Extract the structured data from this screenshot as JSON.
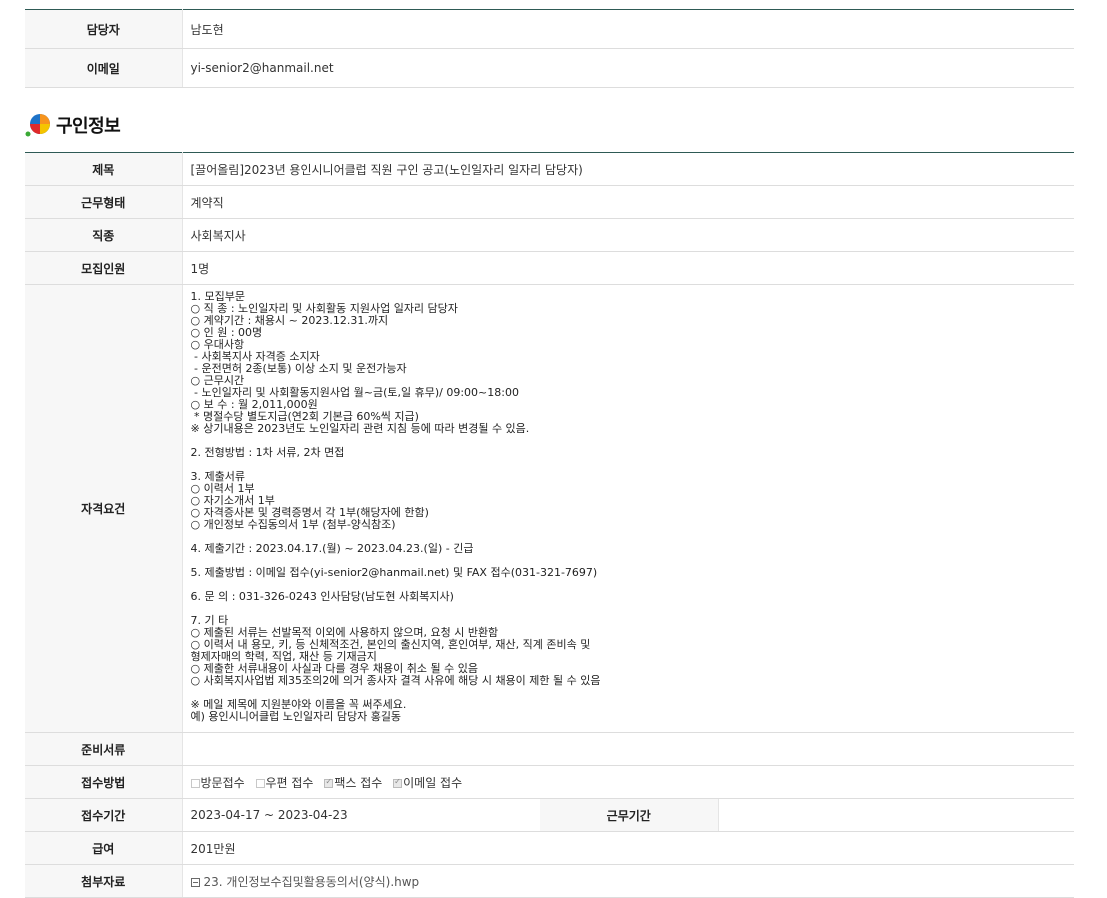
{
  "contact": {
    "manager_label": "담당자",
    "manager_value": "남도현",
    "email_label": "이메일",
    "email_value": "yi-senior2@hanmail.net"
  },
  "section": {
    "title": "구인정보",
    "logo_icon": "colorful-circle-logo-icon"
  },
  "info": {
    "title_label": "제목",
    "title_value": "[끌어올림]2023년 용인시니어클럽 직원 구인 공고(노인일자리 일자리 담당자)",
    "worktype_label": "근무형태",
    "worktype_value": "계약직",
    "job_label": "직종",
    "job_value": "사회복지사",
    "headcount_label": "모집인원",
    "headcount_value": "1명",
    "req_label": "자격요건",
    "req_lines": [
      "1. 모집부문",
      "○ 직 종 : 노인일자리 및 사회활동 지원사업 일자리 담당자",
      "○ 계약기간 : 채용시 ~ 2023.12.31.까지",
      "○ 인 원 : 00명",
      "○ 우대사항",
      " - 사회복지사 자격증 소지자",
      " - 운전면허 2종(보통) 이상 소지 및 운전가능자",
      "○ 근무시간",
      " - 노인일자리 및 사회활동지원사업 월~금(토,일 휴무)/ 09:00~18:00",
      "○ 보 수 : 월 2,011,000원",
      " * 명절수당 별도지급(연2회 기본급 60%씩 지급)",
      "※ 상기내용은 2023년도 노인일자리 관련 지침 등에 따라 변경될 수 있음.",
      "",
      "2. 전형방법 : 1차 서류, 2차 면접",
      "",
      "3. 제출서류",
      "○ 이력서 1부",
      "○ 자기소개서 1부",
      "○ 자격증사본 및 경력증명서 각 1부(해당자에 한함)",
      "○ 개인정보 수집동의서 1부 (첨부-양식참조)",
      "",
      "4. 제출기간 : 2023.04.17.(월) ~ 2023.04.23.(일) - 긴급",
      "",
      "5. 제출방법 : 이메일 접수(yi-senior2@hanmail.net) 및 FAX 접수(031-321-7697)",
      "",
      "6. 문 의 : 031-326-0243 인사담당(남도현 사회복지사)",
      "",
      "7. 기 타",
      "○ 제출된 서류는 선발목적 이외에 사용하지 않으며, 요청 시 반환함",
      "○ 이력서 내 용모, 키, 등 신체적조건, 본인의 출신지역, 혼인여부, 재산, 직계 존비속 및",
      "형제자매의 학력, 직업, 재산 등 기재금지",
      "○ 제출한 서류내용이 사실과 다를 경우 채용이 취소 될 수 있음",
      "○ 사회복지사업법 제35조의2에 의거 종사자 결격 사유에 해당 시 채용이 제한 될 수 있음",
      "",
      "※ 메일 제목에 지원분야와 이름을 꼭 써주세요.",
      "예) 용인시니어클럽 노인일자리 담당자 홍길동"
    ],
    "docs_label": "준비서류",
    "docs_value": "",
    "method_label": "접수방법",
    "method_options": [
      {
        "label": "방문접수",
        "checked": false
      },
      {
        "label": "우편 접수",
        "checked": false
      },
      {
        "label": "팩스 접수",
        "checked": true
      },
      {
        "label": "이메일 접수",
        "checked": true
      }
    ],
    "period_label": "접수기간",
    "period_value": "2023-04-17 ~ 2023-04-23",
    "workperiod_label": "근무기간",
    "workperiod_value": "",
    "salary_label": "급여",
    "salary_value": "201만원",
    "attach_label": "첨부자료",
    "attach_icon": "file-attachment-icon",
    "attach_file": "23. 개인정보수집및활용동의서(양식).hwp"
  }
}
